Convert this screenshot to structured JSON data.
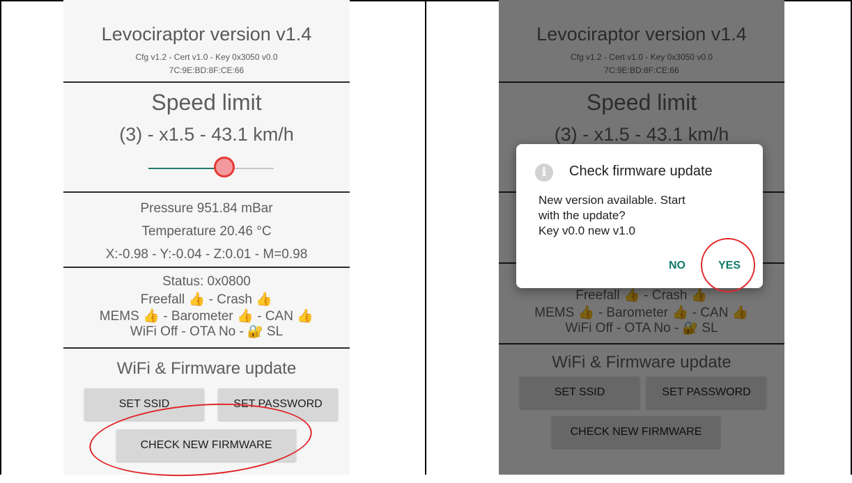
{
  "app": {
    "title": "Levociraptor version v1.4",
    "config_line": "Cfg v1.2 - Cert v1.0 - Key 0x3050 v0.0",
    "mac_address": "7C:9E:BD:8F:CE:66"
  },
  "speed": {
    "title": "Speed limit",
    "value": "(3) - x1.5 - 43.1 km/h",
    "slider_fraction": 0.62
  },
  "sensors": {
    "pressure": "Pressure 951.84 mBar",
    "temperature": "Temperature 20.46 °C",
    "accel": "X:-0.98 - Y:-0.04 - Z:0.01 - M=0.98"
  },
  "status": {
    "code": "Status: 0x0800",
    "freefall": "Freefall",
    "crash": "- Crash",
    "mems": "MEMS",
    "barometer": "- Barometer",
    "can": "- CAN",
    "wifi_ota": "WiFi Off - OTA No -",
    "sl": "SL",
    "thumb_glyph": "👍",
    "lock_glyph": "🔐"
  },
  "wifi": {
    "title": "WiFi & Firmware update",
    "set_ssid": "SET SSID",
    "set_password": "SET PASSWORD",
    "check_firmware": "CHECK NEW FIRMWARE"
  },
  "dialog": {
    "icon": "i",
    "title": "Check firmware update",
    "message_line1": "New version available. Start",
    "message_line2": "with the update?",
    "message_line3": "Key v0.0 new v1.0",
    "no": "NO",
    "yes": "YES"
  },
  "colors": {
    "accent": "#0f7a6a",
    "slider_thumb": "#e53935",
    "annotation": "#e0262a"
  }
}
